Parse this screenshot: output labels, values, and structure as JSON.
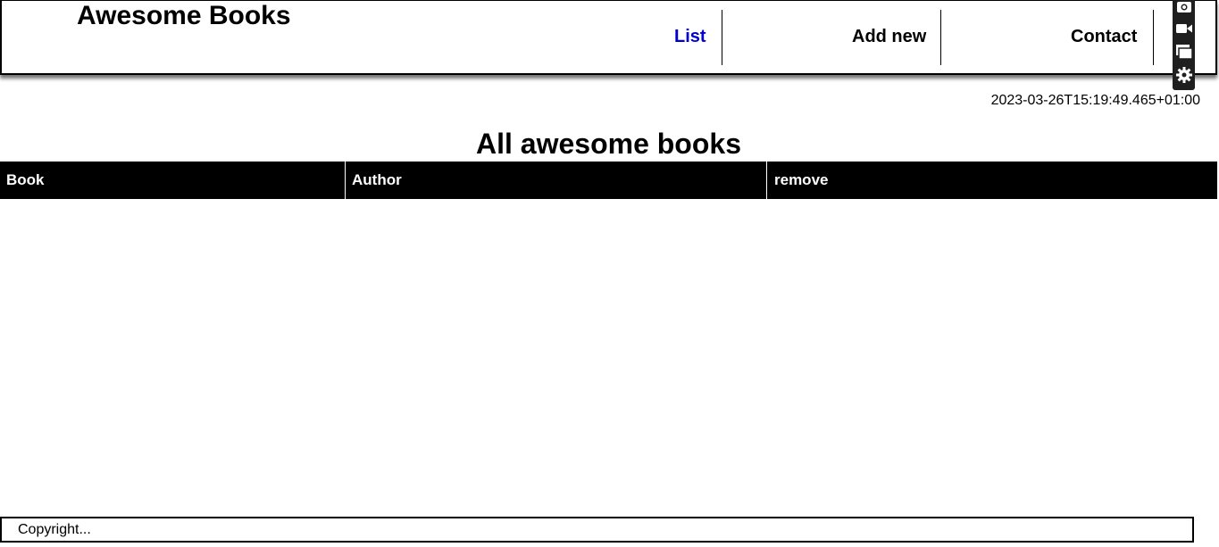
{
  "header": {
    "brand": "Awesome Books",
    "nav": [
      {
        "label": "List"
      },
      {
        "label": "Add new"
      },
      {
        "label": "Contact"
      }
    ]
  },
  "toolbar": {
    "icons": [
      "camera-icon",
      "video-icon",
      "windows-icon",
      "gear-icon"
    ]
  },
  "timestamp": "2023-03-26T15:19:49.465+01:00",
  "main": {
    "title": "All awesome books",
    "table": {
      "columns": [
        "Book",
        "Author",
        "remove"
      ],
      "rows": []
    }
  },
  "footer": {
    "text": "Copyright..."
  },
  "colors": {
    "active_nav": "#0000cc",
    "table_header_bg": "#000000",
    "toolbar_bg": "#1f1f1f"
  }
}
